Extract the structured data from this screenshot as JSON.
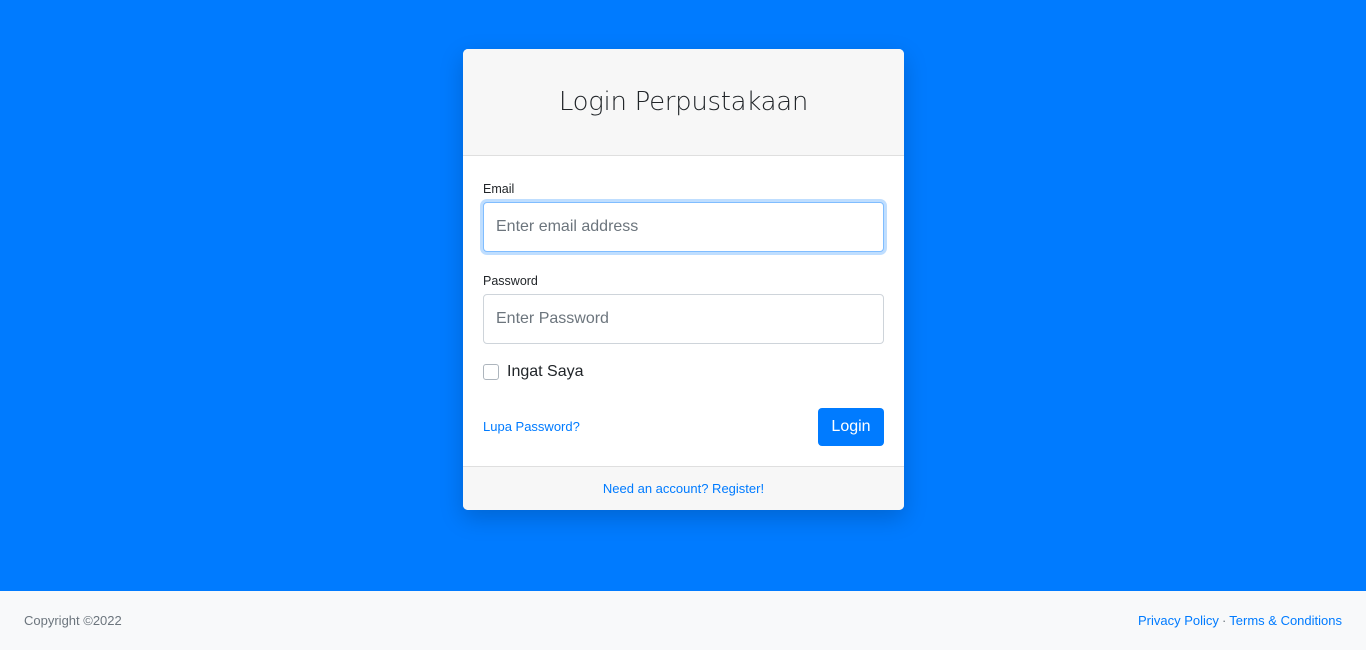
{
  "card": {
    "title": "Login Perpustakaan",
    "email_label": "Email",
    "email_placeholder": "Enter email address",
    "password_label": "Password",
    "password_placeholder": "Enter Password",
    "remember_label": "Ingat Saya",
    "forgot_link": "Lupa Password?",
    "login_button": "Login",
    "register_link": "Need an account? Register!"
  },
  "footer": {
    "copyright": "Copyright ©2022",
    "privacy_link": "Privacy Policy",
    "separator": "·",
    "terms_link": "Terms & Conditions"
  },
  "colors": {
    "background": "#007bff",
    "primary": "#007bff",
    "footer_bg": "#f8f9fa"
  }
}
